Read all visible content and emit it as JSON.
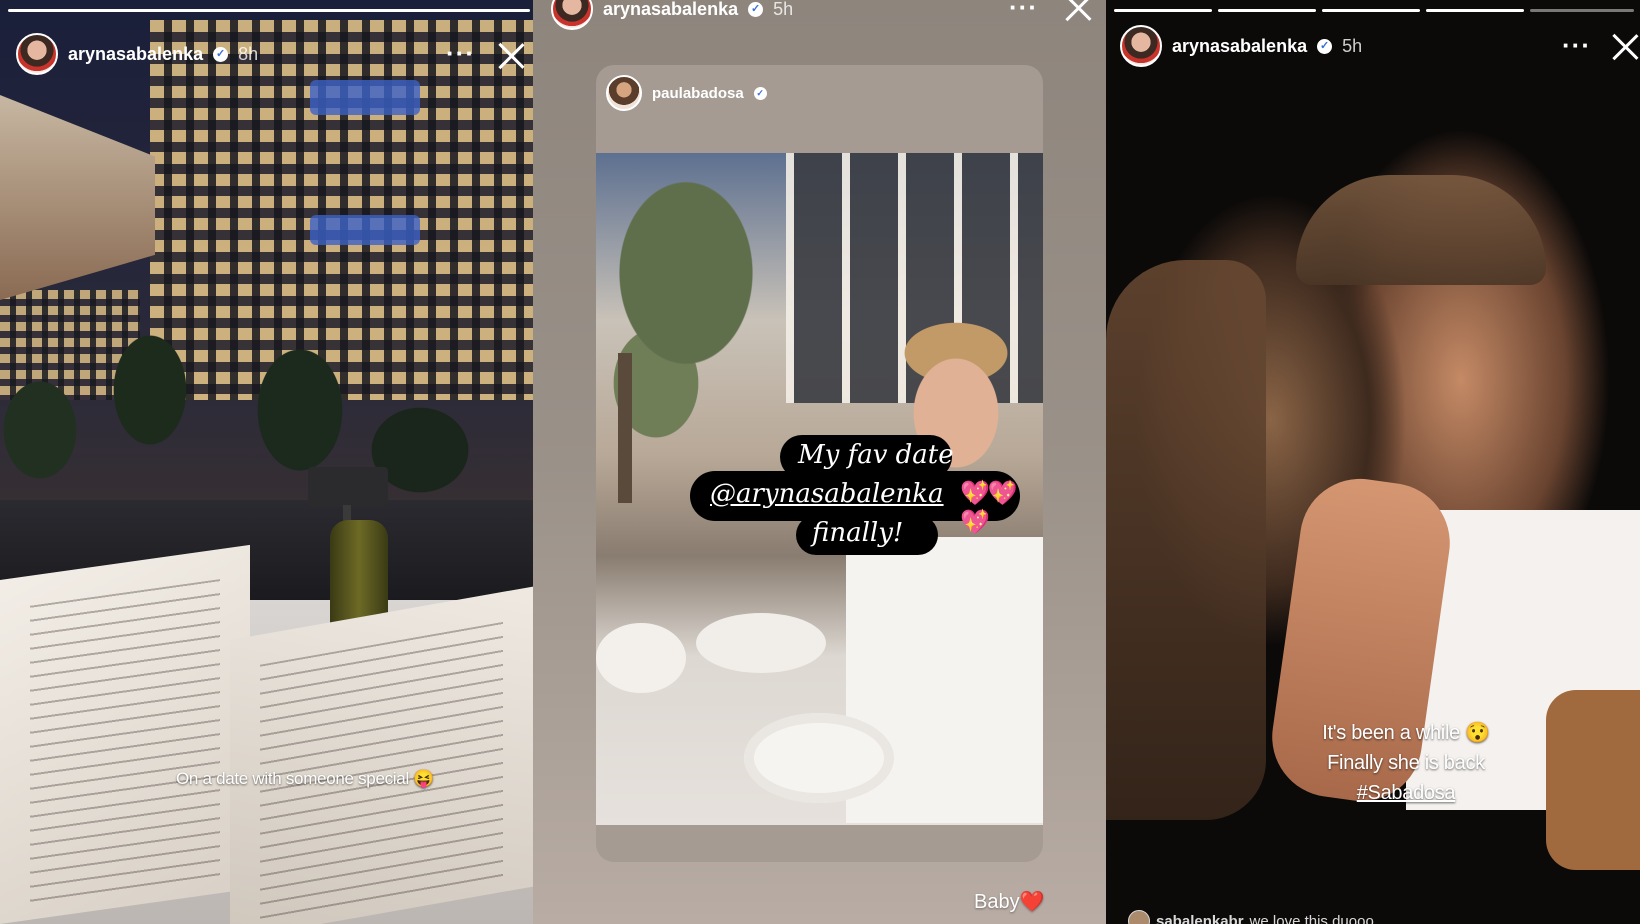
{
  "stories": [
    {
      "username": "arynasabalenka",
      "time": "8h",
      "caption": "On a date with someone special",
      "caption_emoji": "😝",
      "more_label": "···"
    },
    {
      "username": "arynasabalenka",
      "time": "5h",
      "more_label": "···",
      "reshare": {
        "username": "paulabadosa",
        "sticker_line1": "My fav date",
        "sticker_mention": "@arynasabalenka",
        "sticker_hearts": "💖💖💖",
        "sticker_line3": "finally!"
      },
      "caption": "Baby",
      "caption_emoji": "❤️"
    },
    {
      "username": "arynasabalenka",
      "time": "5h",
      "more_label": "···",
      "caption_line1": "It's been a while 😯",
      "caption_line2": "Finally she is back",
      "caption_hashtag": "#Sabadosa",
      "comment_user": "sabalenkabr",
      "comment_text": "we love this duooo"
    }
  ],
  "verified_glyph": "✓",
  "colors": {
    "story2_bg": "#9a9189",
    "heart": "#e2232f",
    "sticker_hearts": "#ff5bb3"
  }
}
